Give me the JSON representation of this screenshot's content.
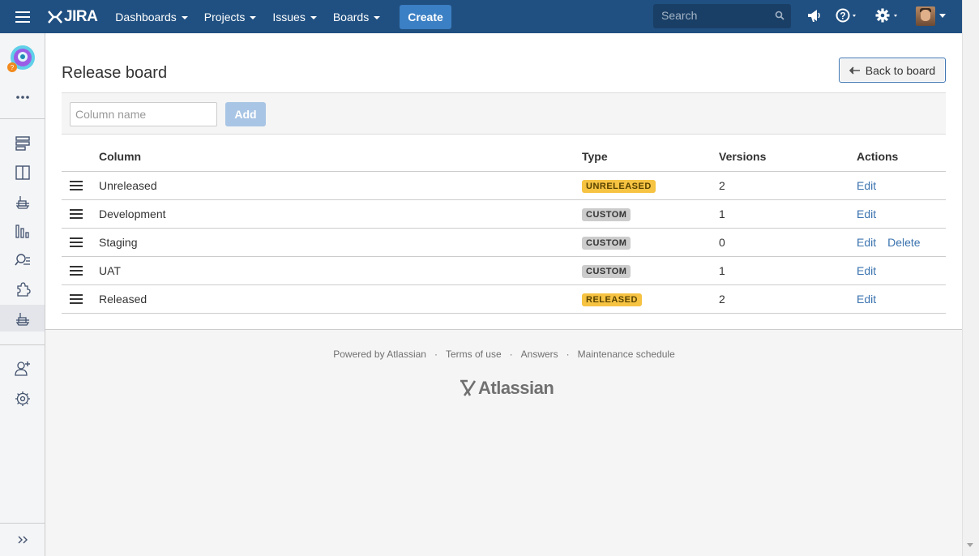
{
  "colors": {
    "nav_bg": "#205081",
    "create_bg": "#3b7fc4",
    "link": "#3b73af",
    "lozenge_yellow": "#f6c342",
    "lozenge_gray": "#cccccc"
  },
  "nav": {
    "logo": "JIRA",
    "items": [
      {
        "label": "Dashboards"
      },
      {
        "label": "Projects"
      },
      {
        "label": "Issues"
      },
      {
        "label": "Boards"
      }
    ],
    "create_label": "Create",
    "search_placeholder": "Search",
    "icons": [
      "menu-icon",
      "megaphone-icon",
      "help-icon",
      "gear-icon",
      "avatar"
    ]
  },
  "sidebar": {
    "icons": [
      "project-avatar",
      "more-icon",
      "backlog-icon",
      "board-icon",
      "releases-icon",
      "reports-icon",
      "issues-search-icon",
      "addons-icon",
      "release-board-icon",
      "add-people-icon",
      "settings-icon",
      "expand-icon"
    ],
    "active": "release-board-icon"
  },
  "page": {
    "title": "Release board",
    "back_label": "Back to board"
  },
  "add_form": {
    "placeholder": "Column name",
    "add_label": "Add"
  },
  "table": {
    "headers": {
      "column": "Column",
      "type": "Type",
      "versions": "Versions",
      "actions": "Actions"
    },
    "rows": [
      {
        "name": "Unreleased",
        "type": "UNRELEASED",
        "type_style": "yellow",
        "versions": "2",
        "edit": "Edit"
      },
      {
        "name": "Development",
        "type": "CUSTOM",
        "type_style": "gray",
        "versions": "1",
        "edit": "Edit"
      },
      {
        "name": "Staging",
        "type": "CUSTOM",
        "type_style": "gray",
        "versions": "0",
        "edit": "Edit",
        "delete": "Delete"
      },
      {
        "name": "UAT",
        "type": "CUSTOM",
        "type_style": "gray",
        "versions": "1",
        "edit": "Edit"
      },
      {
        "name": "Released",
        "type": "RELEASED",
        "type_style": "yellow",
        "versions": "2",
        "edit": "Edit"
      }
    ]
  },
  "footer": {
    "links": [
      "Powered by Atlassian",
      "Terms of use",
      "Answers",
      "Maintenance schedule"
    ],
    "separator": "·",
    "logo_text": "Atlassian"
  }
}
